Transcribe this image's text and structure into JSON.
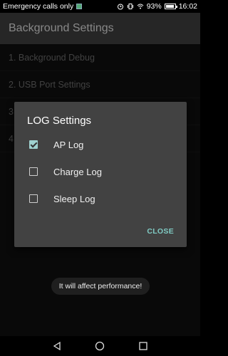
{
  "status_bar": {
    "carrier": "Emergency calls only",
    "battery": "93%",
    "time": "16:02",
    "icons": [
      "alarm-icon",
      "vibrate-icon",
      "wifi-icon",
      "battery-icon"
    ]
  },
  "app": {
    "title": "Background Settings"
  },
  "list": {
    "items": [
      {
        "label": "1. Background Debug"
      },
      {
        "label": "2. USB Port Settings"
      },
      {
        "label": "3"
      },
      {
        "label": "4"
      }
    ]
  },
  "dialog": {
    "title": "LOG Settings",
    "options": [
      {
        "label": "AP Log",
        "checked": true
      },
      {
        "label": "Charge Log",
        "checked": false
      },
      {
        "label": "Sleep Log",
        "checked": false
      }
    ],
    "close_label": "CLOSE"
  },
  "toast": {
    "text": "It will affect performance!"
  },
  "nav_bar": {
    "icons": [
      "back-icon",
      "home-icon",
      "recents-icon"
    ]
  }
}
